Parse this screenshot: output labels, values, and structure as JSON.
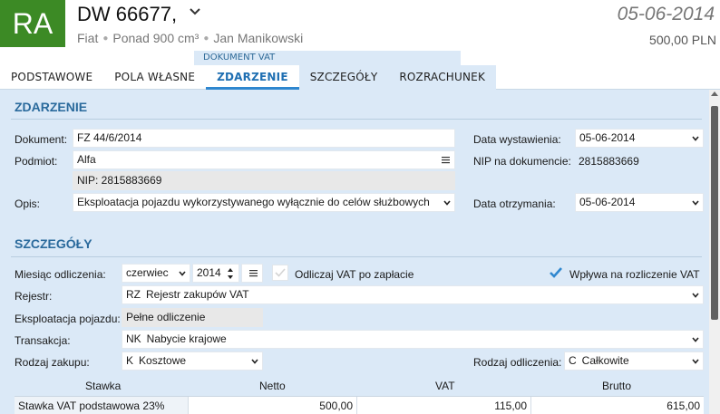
{
  "header": {
    "avatar": "RA",
    "title": "DW 66677,",
    "make": "Fiat",
    "engine": "Ponad 900 cm³",
    "person": "Jan Manikowski",
    "date": "05-06-2014",
    "amount": "500,00 PLN"
  },
  "tabs": {
    "group_label": "DOKUMENT VAT",
    "items": [
      "PODSTAWOWE",
      "POLA WŁASNE",
      "ZDARZENIE",
      "SZCZEGÓŁY",
      "ROZRACHUNEK"
    ],
    "active": "ZDARZENIE"
  },
  "zdarzenie": {
    "title": "ZDARZENIE",
    "dokument_label": "Dokument:",
    "dokument_value": "FZ 44/6/2014",
    "podmiot_label": "Podmiot:",
    "podmiot_value": "Alfa",
    "nip_text": "NIP:  2815883669",
    "opis_label": "Opis:",
    "opis_value": "Eksploatacja pojazdu wykorzystywanego wyłącznie do celów służbowych",
    "data_wystawienia_label": "Data wystawienia:",
    "data_wystawienia_value": "05-06-2014",
    "nip_dok_label": "NIP na dokumencie:",
    "nip_dok_value": "2815883669",
    "data_otrzymania_label": "Data otrzymania:",
    "data_otrzymania_value": "05-06-2014"
  },
  "szczegoly": {
    "title": "SZCZEGÓŁY",
    "miesiac_label": "Miesiąc odliczenia:",
    "miesiac_value": "czerwiec",
    "rok_value": "2014",
    "odliczaj_label": "Odliczaj VAT po zapłacie",
    "odliczaj_checked": false,
    "wplywa_label": "Wpływa na rozliczenie VAT",
    "wplywa_checked": true,
    "rejestr_label": "Rejestr:",
    "rejestr_code": "RZ",
    "rejestr_value": "Rejestr zakupów VAT",
    "eksploatacja_label": "Eksploatacja pojazdu:",
    "eksploatacja_value": "Pełne odliczenie",
    "transakcja_label": "Transakcja:",
    "transakcja_code": "NK",
    "transakcja_value": "Nabycie krajowe",
    "rodzaj_zakupu_label": "Rodzaj zakupu:",
    "rodzaj_zakupu_code": "K",
    "rodzaj_zakupu_value": "Kosztowe",
    "rodzaj_odliczenia_label": "Rodzaj odliczenia:",
    "rodzaj_odliczenia_code": "C",
    "rodzaj_odliczenia_value": "Całkowite"
  },
  "table": {
    "headers": [
      "Stawka",
      "Netto",
      "VAT",
      "Brutto"
    ],
    "rows": [
      [
        "Stawka VAT podstawowa 23%",
        "500,00",
        "115,00",
        "615,00"
      ]
    ]
  },
  "colors": {
    "avatar_bg": "#3c8a25",
    "accent": "#2f87cf",
    "panel_bg": "#dbe9f7"
  }
}
